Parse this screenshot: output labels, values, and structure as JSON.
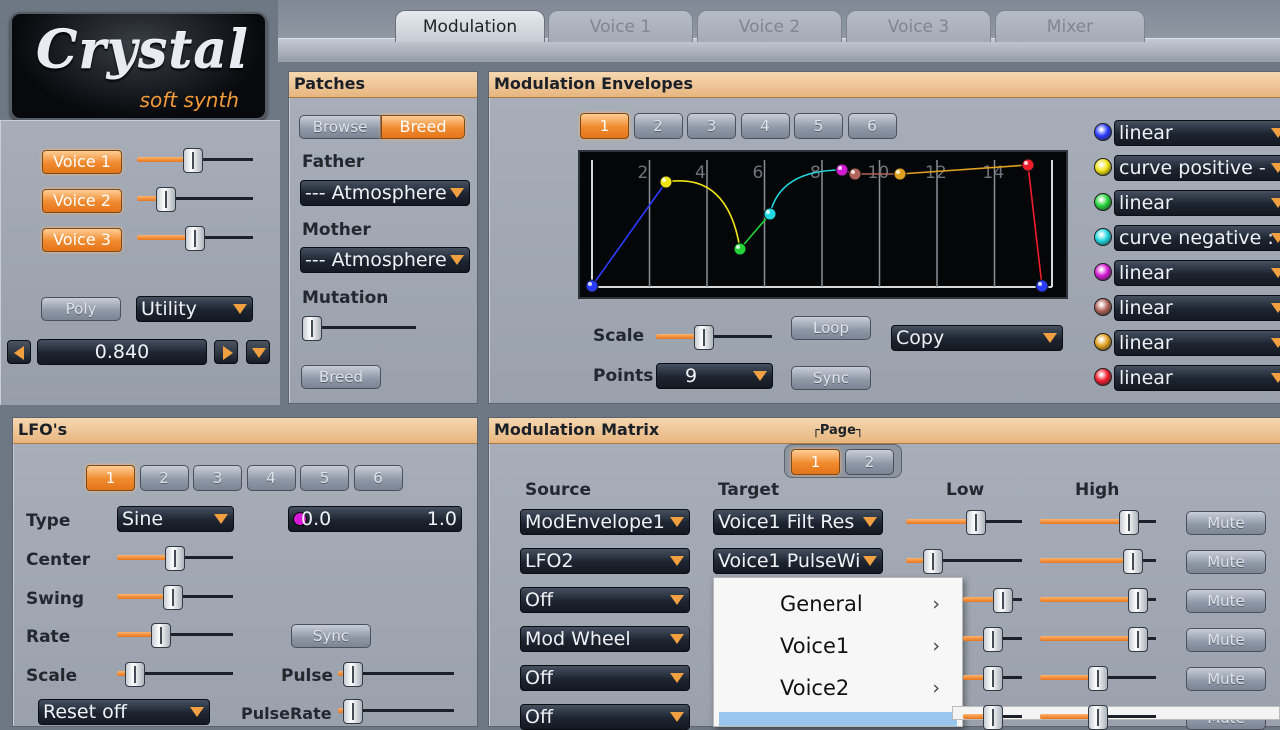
{
  "tabs": [
    {
      "label": "Modulation",
      "active": true
    },
    {
      "label": "Voice 1",
      "active": false
    },
    {
      "label": "Voice 2",
      "active": false
    },
    {
      "label": "Voice 3",
      "active": false
    },
    {
      "label": "Mixer",
      "active": false
    }
  ],
  "logo": {
    "title": "Crystal",
    "subtitle": "soft synth"
  },
  "voices": [
    {
      "label": "Voice 1",
      "level": 0.48
    },
    {
      "label": "Voice 2",
      "level": 0.2
    },
    {
      "label": "Voice 3",
      "level": 0.5
    }
  ],
  "poly_label": "Poly",
  "utility_label": "Utility",
  "value_display": "0.840",
  "patches": {
    "title": "Patches",
    "browse_label": "Browse",
    "breed_tab_label": "Breed",
    "father_label": "Father",
    "father_value": "--- Atmosphere",
    "mother_label": "Mother",
    "mother_value": "--- Atmosphere",
    "mutation_label": "Mutation",
    "mutation_level": 0.0,
    "breed_button": "Breed"
  },
  "envelopes": {
    "title": "Modulation Envelopes",
    "tabs": [
      "1",
      "2",
      "3",
      "4",
      "5",
      "6"
    ],
    "selected_tab": "1",
    "grid_labels": [
      "2",
      "4",
      "6",
      "8",
      "10",
      "12",
      "14"
    ],
    "scale_label": "Scale",
    "scale_level": 0.4,
    "points_label": "Points",
    "points_value": "9",
    "loop_label": "Loop",
    "sync_label": "Sync",
    "copy_label": "Copy",
    "curve_colors": [
      "#2a3cff",
      "#f0e414",
      "#24d23a",
      "#22d8e0",
      "#d21ad2",
      "#b0645a",
      "#e0a020",
      "#f01c2c"
    ],
    "curves": [
      "linear",
      "curve positive -",
      "linear",
      "curve negative :",
      "linear",
      "linear",
      "linear",
      "linear"
    ]
  },
  "lfos": {
    "title": "LFO's",
    "tabs": [
      "1",
      "2",
      "3",
      "4",
      "5",
      "6"
    ],
    "selected_tab": "1",
    "type_label": "Type",
    "type_value": "Sine",
    "range_left": "0.0",
    "range_right": "1.0",
    "center_label": "Center",
    "center_level": 0.5,
    "swing_label": "Swing",
    "swing_level": 0.48,
    "rate_label": "Rate",
    "rate_level": 0.35,
    "sync_label": "Sync",
    "scale_label": "Scale",
    "scale_level": 0.08,
    "pulse_label": "Pulse",
    "pulse_level": 0.05,
    "reset_label": "Reset off",
    "pulserate_label": "PulseRate",
    "pulserate_level": 0.05
  },
  "matrix": {
    "title": "Modulation Matrix",
    "page_label": "Page",
    "pages": [
      "1",
      "2"
    ],
    "selected_page": "1",
    "col_source": "Source",
    "col_target": "Target",
    "col_low": "Low",
    "col_high": "High",
    "mute_label": "Mute",
    "rows": [
      {
        "source": "ModEnvelope1",
        "target": "Voice1 Filt Res",
        "low": 0.62,
        "high": 0.82
      },
      {
        "source": "LFO2",
        "target": "Voice1 PulseWi",
        "low": 0.18,
        "high": 0.86
      },
      {
        "source": "Off",
        "target": "",
        "low": 0.78,
        "high": 0.92
      },
      {
        "source": "Mod Wheel",
        "target": "",
        "low": 0.5,
        "high": 0.92
      },
      {
        "source": "Off",
        "target": "",
        "low": 0.5,
        "high": 0.5
      },
      {
        "source": "Off",
        "target": "",
        "low": 0.5,
        "high": 0.5
      }
    ]
  },
  "context_menu": {
    "items": [
      "General",
      "Voice1",
      "Voice2"
    ]
  }
}
